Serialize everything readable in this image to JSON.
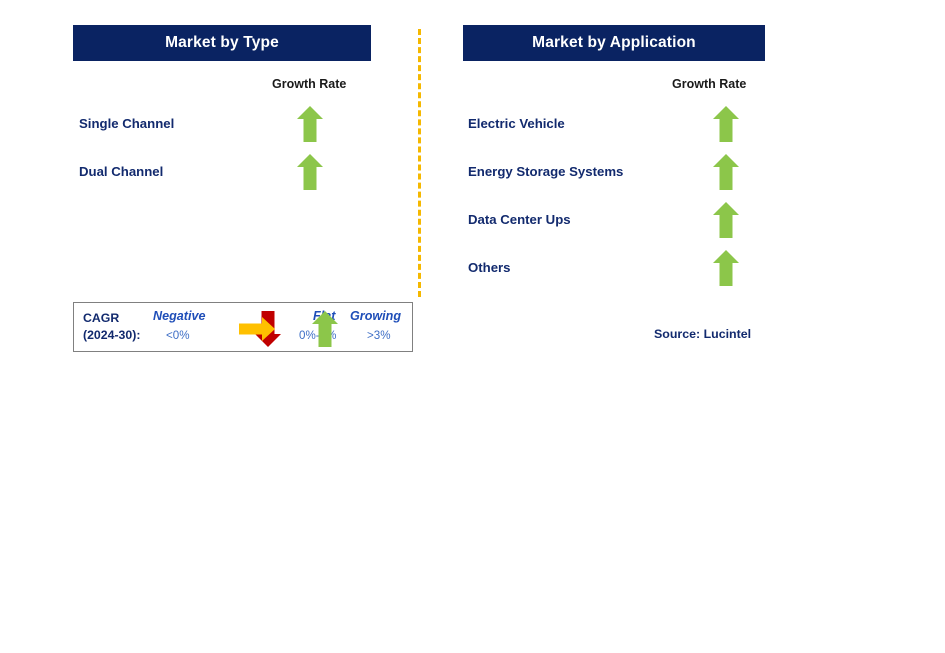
{
  "divider": {
    "style": "dashed-vertical",
    "color": "#f5b800"
  },
  "panels": [
    {
      "id": "market-by-type",
      "title": "Market by Type",
      "header_bg": "#0a2362",
      "header_text_color": "#ffffff",
      "growth_rate_caption": "Growth Rate",
      "rows": [
        {
          "label": "Single Channel",
          "growth": "growing",
          "arrow_icon": "arrow-up-icon",
          "arrow_color": "#8cc64a"
        },
        {
          "label": "Dual Channel",
          "growth": "growing",
          "arrow_icon": "arrow-up-icon",
          "arrow_color": "#8cc64a"
        }
      ]
    },
    {
      "id": "market-by-application",
      "title": "Market by Application",
      "header_bg": "#0a2362",
      "header_text_color": "#ffffff",
      "growth_rate_caption": "Growth Rate",
      "rows": [
        {
          "label": "Electric Vehicle",
          "growth": "growing",
          "arrow_icon": "arrow-up-icon",
          "arrow_color": "#8cc64a"
        },
        {
          "label": "Energy Storage Systems",
          "growth": "growing",
          "arrow_icon": "arrow-up-icon",
          "arrow_color": "#8cc64a"
        },
        {
          "label": "Data Center Ups",
          "growth": "growing",
          "arrow_icon": "arrow-up-icon",
          "arrow_color": "#8cc64a"
        },
        {
          "label": "Others",
          "growth": "growing",
          "arrow_icon": "arrow-up-icon",
          "arrow_color": "#8cc64a"
        }
      ]
    }
  ],
  "legend": {
    "cagr_line1": "CAGR",
    "cagr_line2": "(2024-30):",
    "items": [
      {
        "title": "Negative",
        "range": "<0%",
        "arrow_icon": "arrow-down-icon",
        "arrow_color": "#c00000"
      },
      {
        "title": "Flat",
        "range": "0%-3%",
        "arrow_icon": "arrow-right-icon",
        "arrow_color": "#ffc000"
      },
      {
        "title": "Growing",
        "range": ">3%",
        "arrow_icon": "arrow-up-icon",
        "arrow_color": "#8cc64a"
      }
    ]
  },
  "source": "Source: Lucintel"
}
